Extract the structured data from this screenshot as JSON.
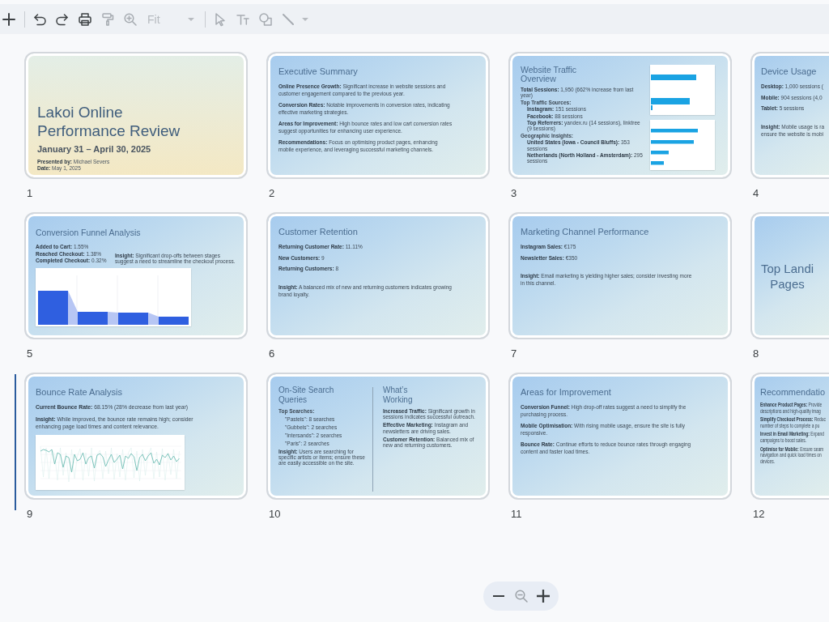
{
  "toolbar": {
    "groups": [
      [
        {
          "kind": "add",
          "disabled": false
        }
      ],
      [
        {
          "kind": "undo",
          "disabled": false
        },
        {
          "kind": "redo",
          "disabled": false
        },
        {
          "kind": "print",
          "disabled": false
        },
        {
          "kind": "paint-format",
          "disabled": true
        },
        {
          "kind": "zoom",
          "disabled": true
        },
        {
          "kind": "dropdown",
          "value": "Fit",
          "disabled": true
        }
      ],
      [
        {
          "kind": "select",
          "disabled": true
        },
        {
          "kind": "text",
          "disabled": true
        },
        {
          "kind": "shape",
          "disabled": true
        },
        {
          "kind": "line",
          "disabled": true
        },
        {
          "kind": "caret",
          "disabled": true
        }
      ]
    ]
  },
  "slides": [
    {
      "number": "1",
      "kind": "title",
      "selected": false,
      "title": "Lakoi Online Performance Review",
      "subtitle": "January 31 – April 30, 2025",
      "meta": [
        "**Presented by:** Michael Severs",
        "**Date:** May 1, 2025"
      ]
    },
    {
      "number": "2",
      "kind": "bullets",
      "selected": false,
      "title": "Executive Summary",
      "paragraphs": [
        {
          "text": "**Online Presence Growth:** Significant increase in website sessions and customer engagement compared to the previous year."
        },
        {
          "text": "**Conversion Rates:** Notable improvements in conversion rates, indicating effective marketing strategies."
        },
        {
          "text": "**Areas for Improvement:** High bounce rates and low cart conversion rates suggest opportunities for enhancing user experience."
        },
        {
          "text": "**Recommendations:** Focus on optimising product pages, enhancing mobile experience, and leveraging successful marketing channels."
        }
      ]
    },
    {
      "number": "3",
      "kind": "traffic",
      "selected": false,
      "title": "Website Traffic Overview",
      "paragraphs": [
        {
          "text": "**Total Sessions:** 1,950 (662% increase from last year)"
        },
        {
          "text": "Top Traffic Sources:",
          "children": [
            {
              "text": "**Instagram:** 151 sessions"
            },
            {
              "text": "**Facebook:** 88 sessions"
            },
            {
              "text": "**Top Referrers:** yandex.ru (14 sessions), linktree (9 sessions)"
            }
          ]
        },
        {
          "text": "Geographic Insights:",
          "children": [
            {
              "text": "**United States (Iowa - Council Bluffs):** 353 sessions"
            },
            {
              "text": "**Netherlands (North Holland - Amsterdam):** 295 sessions"
            }
          ]
        }
      ]
    },
    {
      "number": "4",
      "kind": "bullets",
      "selected": false,
      "title": "Device Usage",
      "paragraphs": [
        {
          "text": "**Desktop:** 1,000 sessions ("
        },
        {
          "text": "**Mobile:** 904 sessions (4,0"
        },
        {
          "text": "**Tablet:** 5 sessions"
        }
      ],
      "insight": "**Insight:** Mobile usage is ra\nensure the website is mobi"
    },
    {
      "number": "5",
      "kind": "funnel",
      "selected": false,
      "title": "Conversion Funnel Analysis",
      "paragraphs": [
        {
          "text": "**Added to Cart:** 1.55%"
        },
        {
          "text": "**Reached Checkout:** 1.38%"
        },
        {
          "text": "**Completed Checkout:** 0.32%"
        }
      ],
      "insight": "**Insight:** Significant drop-offs between stages suggest a need to streamline the checkout process."
    },
    {
      "number": "6",
      "kind": "bullets",
      "selected": false,
      "title": "Customer Retention",
      "paragraphs": [
        {
          "text": "**Returning Customer Rate:** 11.11%"
        },
        {
          "text": "**New Customers:** 9"
        },
        {
          "text": "**Returning Customers:** 8"
        }
      ],
      "insight": "**Insight:** A balanced mix of new and returning customers indicates growing brand loyalty."
    },
    {
      "number": "7",
      "kind": "bullets",
      "selected": false,
      "title": "Marketing Channel Performance",
      "paragraphs": [
        {
          "text": "**Instagram Sales:** €175"
        },
        {
          "text": "**Newsletter Sales:** €350"
        }
      ],
      "insight": "**Insight:** Email marketing is yielding higher sales; consider investing more in this channel."
    },
    {
      "number": "8",
      "kind": "section",
      "selected": false,
      "title": "Top Landi\nPages"
    },
    {
      "number": "9",
      "kind": "line-chart",
      "selected": true,
      "title": "Bounce Rate Analysis",
      "paragraphs": [
        {
          "text": "**Current Bounce Rate:** 68.15% (28% decrease from last year)"
        }
      ],
      "insight": "**Insight:** While improved, the bounce rate remains high; consider enhancing page load times and content relevance."
    },
    {
      "number": "10",
      "kind": "two-column",
      "selected": false,
      "columns": [
        {
          "title": "On-Site Search Queries",
          "paragraphs": [
            {
              "text": "Top Searches:",
              "children": [
                {
                  "text": "\"Pastels\": 8 searches"
                },
                {
                  "text": "\"Gubbels\": 2 searches"
                },
                {
                  "text": "\"Intersands\": 2 searches"
                },
                {
                  "text": "\"Paris\": 2 searches"
                }
              ]
            }
          ],
          "insight": "**Insight:** Users are searching for specific artists or items; ensure these are easily accessible on the site."
        },
        {
          "title": "What’s Working",
          "paragraphs": [
            {
              "text": "**Increased Traffic:** Significant growth in sessions indicates successful outreach."
            },
            {
              "text": "**Effective Marketing:** Instagram and newsletters are driving sales."
            },
            {
              "text": "**Customer Retention:** Balanced mix of new and returning customers."
            }
          ]
        }
      ]
    },
    {
      "number": "11",
      "kind": "bullets",
      "selected": false,
      "title": "Areas for Improvement",
      "paragraphs": [
        {
          "text": "**Conversion Funnel:** High drop-off rates suggest a need to simplify the purchasing process."
        },
        {
          "text": "**Mobile Optimisation:** With rising mobile usage, ensure the site is fully responsive."
        },
        {
          "text": "**Bounce Rate:** Continue efforts to reduce bounce rates through engaging content and faster load times."
        }
      ]
    },
    {
      "number": "12",
      "kind": "dense",
      "selected": false,
      "title": "Recommendatio",
      "paragraphs": [
        {
          "text": "**Enhance Product Pages:** Provide\ndescriptions and high-quality imag"
        },
        {
          "text": "**Simplify Checkout Process:** Reduc\nnumber of steps to complete a pu"
        },
        {
          "text": "**Invest in Email Marketing:** Expand\ncampaigns to boost sales."
        },
        {
          "text": "**Optimise for Mobile:** Ensure seam\nnavigation and quick load times on\ndevices."
        }
      ]
    }
  ],
  "zoom_bar": {
    "buttons": [
      {
        "kind": "zoom-out",
        "disabled": false
      },
      {
        "kind": "zoom-reset",
        "disabled": true
      },
      {
        "kind": "zoom-in",
        "disabled": false
      }
    ]
  }
}
